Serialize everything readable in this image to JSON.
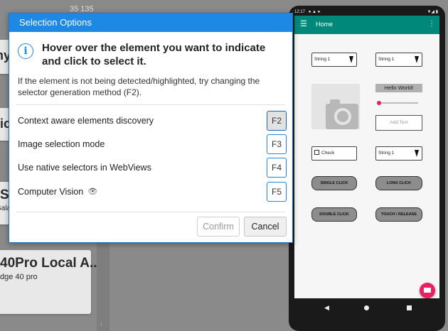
{
  "background": {
    "top_right_text": "35 135",
    "card1_title_fragment": "ny",
    "card2_title_fragment": "tic",
    "card3_title_fragment": "S",
    "card3_sub_fragment": "Gala",
    "card4_title": "40Pro Local A...",
    "card4_sub": "dge 40 pro"
  },
  "dialog": {
    "title": "Selection Options",
    "heading": "Hover over the element you want to indicate and click to select it.",
    "help_text": "If the element is not being detected/highlighted, try changing the selector generation method (F2).",
    "options": [
      {
        "label": "Context aware elements discovery",
        "key": "F2",
        "active": true
      },
      {
        "label": "Image selection mode",
        "key": "F3",
        "active": false
      },
      {
        "label": "Use native selectors in WebViews",
        "key": "F4",
        "active": false
      },
      {
        "label": "Computer Vision",
        "key": "F5",
        "active": false
      }
    ],
    "confirm_label": "Confirm",
    "cancel_label": "Cancel"
  },
  "phone": {
    "status_time": "12:17",
    "appbar_title": "Home",
    "spinner1": "String 1",
    "spinner2": "String 1",
    "spinner3": "String 1",
    "hello_text": "Hello World!",
    "add_text_placeholder": "Add Text",
    "checkbox_label": "Check",
    "single_click": "SINGLE CLICK",
    "long_click": "LONG CLICK",
    "double_click": "DOUBLE CLICK",
    "touch_release": "TOUCH / RELEASE",
    "accent": "#00897b",
    "fab_color": "#e91e63"
  }
}
